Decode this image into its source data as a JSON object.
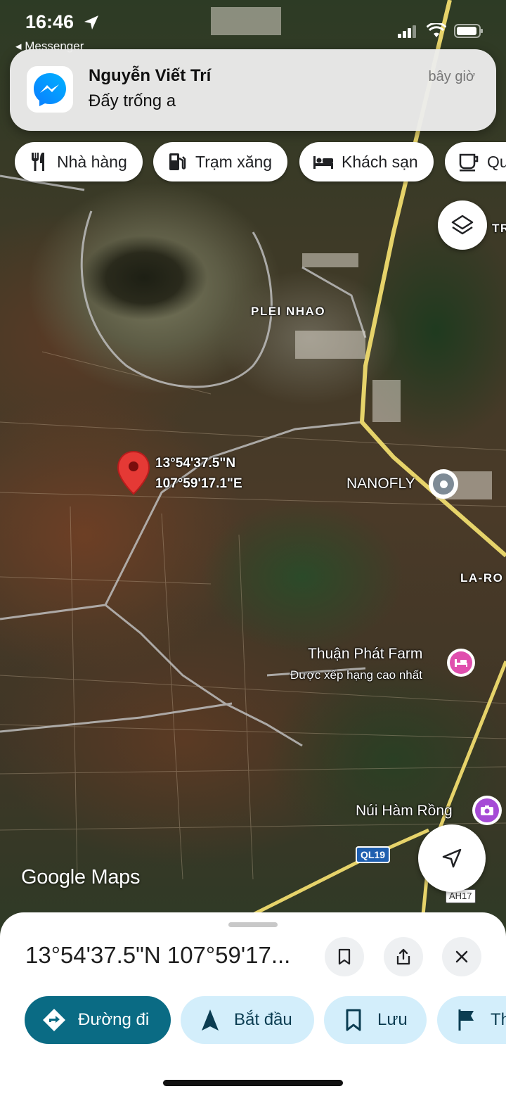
{
  "status_bar": {
    "time": "16:46",
    "back_app": "◂ Messenger"
  },
  "notification": {
    "app_icon": "messenger-icon",
    "sender": "Nguyễn Viết Trí",
    "message": "Đấy trống a",
    "time": "bây giờ"
  },
  "chips": [
    {
      "label": "Nhà hàng",
      "icon": "restaurant-icon"
    },
    {
      "label": "Trạm xăng",
      "icon": "gas-station-icon"
    },
    {
      "label": "Khách sạn",
      "icon": "hotel-icon"
    },
    {
      "label": "Qu",
      "icon": "coffee-icon"
    }
  ],
  "map": {
    "labels": {
      "plei_nhao": "PLEI NHAO",
      "pin_lat": "13°54'37.5\"N",
      "pin_lng": "107°59'17.1\"E",
      "nanofly": "NANOFLY",
      "la_ro": "LA-RO",
      "tr": "TR",
      "thuan_phat": "Thuận Phát Farm",
      "thuan_phat_sub": "Được xếp hạng cao nhất",
      "nui_ham_rong": "Núi Hàm Rồng",
      "ql19": "QL19",
      "ah17": "AH17"
    },
    "brand": "Google Maps",
    "colors": {
      "pin": "#e53935",
      "hotel": "#e04fae",
      "attraction": "#a64bd6",
      "road_major": "#e6d36a"
    }
  },
  "sheet": {
    "title": "13°54'37.5\"N 107°59'17...",
    "icons": [
      "bookmark-icon",
      "share-icon",
      "close-icon"
    ],
    "actions": [
      {
        "label": "Đường đi",
        "icon": "directions-icon"
      },
      {
        "label": "Bắt đầu",
        "icon": "navigation-icon"
      },
      {
        "label": "Lưu",
        "icon": "bookmark-icon"
      },
      {
        "label": "Th",
        "icon": "flag-icon"
      }
    ]
  }
}
